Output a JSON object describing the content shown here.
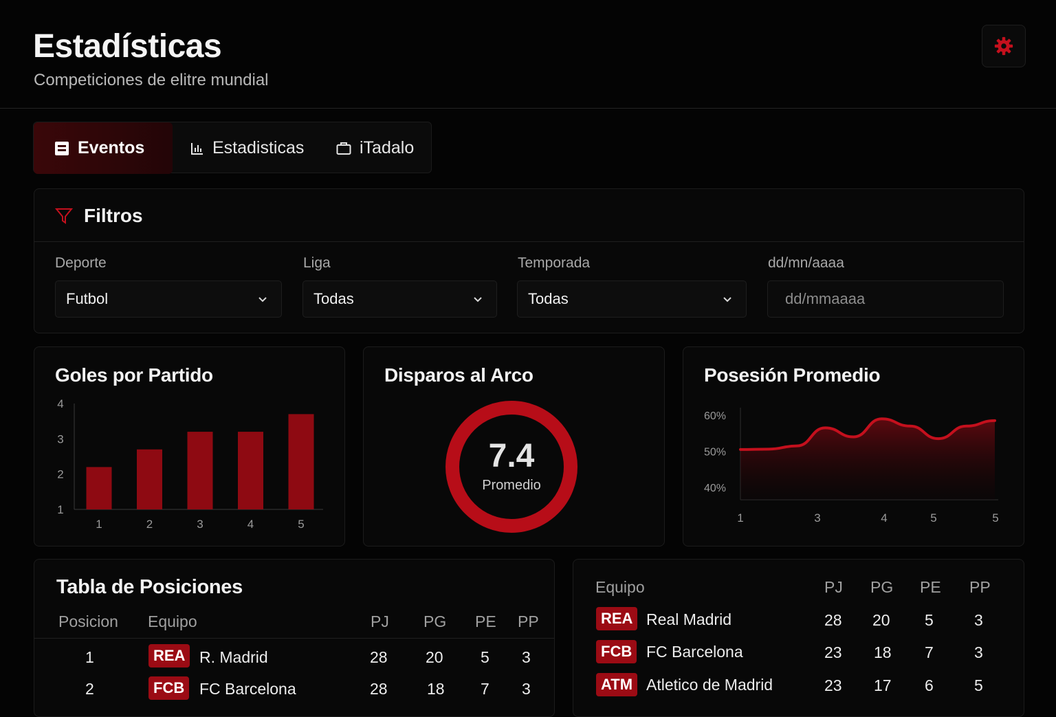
{
  "header": {
    "title": "Estadísticas",
    "subtitle": "Competiciones de elitre mundial"
  },
  "tabs": [
    {
      "label": "Eventos",
      "icon": "calendar-icon",
      "active": true
    },
    {
      "label": "Estadisticas",
      "icon": "bar-chart-icon",
      "active": false
    },
    {
      "label": "iTadalo",
      "icon": "briefcase-icon",
      "active": false
    }
  ],
  "filters": {
    "title": "Filtros",
    "sport": {
      "label": "Deporte",
      "value": "Futbol"
    },
    "league": {
      "label": "Liga",
      "value": "Todas"
    },
    "season": {
      "label": "Temporada",
      "value": "Todas"
    },
    "date": {
      "label": "dd/mn/aaaa",
      "placeholder": "dd/mmaaaa"
    }
  },
  "goals_card": {
    "title": "Goles por Partido"
  },
  "shots_card": {
    "title": "Disparos al Arco",
    "value": "7.4",
    "caption": "Promedio"
  },
  "possession_card": {
    "title": "Posesión Promedio"
  },
  "chart_data": [
    {
      "type": "bar",
      "title": "Goles por Partido",
      "categories": [
        "1",
        "2",
        "3",
        "4",
        "5"
      ],
      "values": [
        2.2,
        2.7,
        3.2,
        3.2,
        3.7
      ],
      "yticks": [
        "1",
        "2",
        "3",
        "4"
      ],
      "ylim": [
        1,
        4
      ],
      "color": "#8e0a12"
    },
    {
      "type": "area",
      "title": "Posesión Promedio",
      "xticks": [
        "1",
        "3",
        "4",
        "5",
        "5"
      ],
      "yticks": [
        "60%",
        "50%",
        "40%"
      ],
      "ylim": [
        40,
        60
      ],
      "values": [
        50.5,
        50.6,
        51.5,
        56.5,
        54,
        59,
        57,
        53.5,
        57,
        58.5
      ],
      "color": "#c4101d"
    }
  ],
  "standings": {
    "title": "Tabla de Posiciones",
    "columns": [
      "Posicion",
      "Equipo",
      "PJ",
      "PG",
      "PE",
      "PP"
    ],
    "rows": [
      {
        "pos": "1",
        "abbr": "REA",
        "team": "R. Madrid",
        "pj": "28",
        "pg": "20",
        "pe": "5",
        "pp": "3"
      },
      {
        "pos": "2",
        "abbr": "FCB",
        "team": "FC Barcelona",
        "pj": "28",
        "pg": "18",
        "pe": "7",
        "pp": "3"
      }
    ]
  },
  "standings2": {
    "columns": [
      "Equipo",
      "PJ",
      "PG",
      "PE",
      "PP"
    ],
    "rows": [
      {
        "abbr": "REA",
        "team": "Real Madrid",
        "pj": "28",
        "pg": "20",
        "pe": "5",
        "pp": "3"
      },
      {
        "abbr": "FCB",
        "team": "FC Barcelona",
        "pj": "23",
        "pg": "18",
        "pe": "7",
        "pp": "3"
      },
      {
        "abbr": "ATM",
        "team": "Atletico de Madrid",
        "pj": "23",
        "pg": "17",
        "pe": "6",
        "pp": "5"
      }
    ]
  },
  "colors": {
    "accent": "#c4101d",
    "background": "#040404",
    "card": "#080808"
  }
}
